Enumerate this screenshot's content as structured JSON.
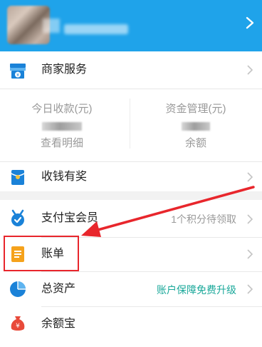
{
  "header": {
    "avatar_icon": "avatar",
    "chevron_icon": "chevron-right-icon",
    "bg_color": "#1fa3ea"
  },
  "menu": {
    "merchant": {
      "label": "商家服务",
      "icon": "store-icon"
    },
    "balance": {
      "today_receipts_title": "今日收款(元)",
      "today_receipts_link": "查看明细",
      "funds_title": "资金管理(元)",
      "funds_link": "余额"
    },
    "reward": {
      "label": "收钱有奖",
      "icon": "red-envelope-icon"
    },
    "member": {
      "label": "支付宝会员",
      "icon": "member-icon",
      "right_text": "1个积分待领取"
    },
    "bill": {
      "label": "账单",
      "icon": "bill-icon"
    },
    "assets": {
      "label": "总资产",
      "icon": "pie-chart-icon",
      "right_text": "账户保障免费升级",
      "right_color": "#1aa89a"
    },
    "yuebao": {
      "label": "余额宝",
      "icon": "money-bag-icon"
    }
  },
  "annotation": {
    "color": "#e8262c"
  }
}
